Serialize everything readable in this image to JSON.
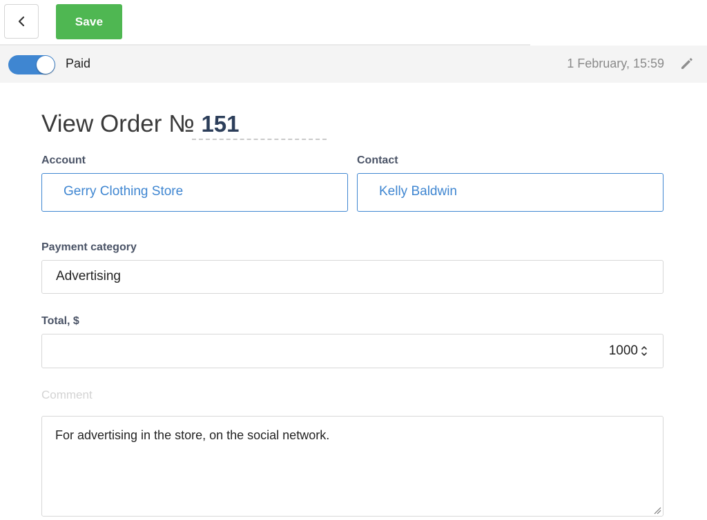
{
  "toolbar": {
    "back_icon": "chevron-left-icon",
    "save_label": "Save",
    "save_color": "#4fb752"
  },
  "status_bar": {
    "paid_label": "Paid",
    "paid_toggle_on": true,
    "toggle_color": "#3f86d1",
    "date": "1 February, 15:59",
    "edit_icon": "pencil-icon"
  },
  "order": {
    "title_prefix": "View Order №",
    "number": "151"
  },
  "fields": {
    "account": {
      "label": "Account",
      "value": "Gerry Clothing Store"
    },
    "contact": {
      "label": "Contact",
      "value": "Kelly Baldwin"
    },
    "payment_category": {
      "label": "Payment category",
      "value": "Advertising"
    },
    "total": {
      "label": "Total, $",
      "value": "1000"
    },
    "comment": {
      "label": "Comment",
      "value": "For advertising in the store, on the social network."
    }
  },
  "colors": {
    "link": "#3f86d1",
    "title_number": "#2c3e5a"
  }
}
